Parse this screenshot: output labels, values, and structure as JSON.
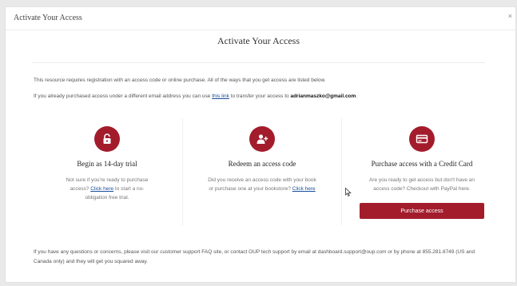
{
  "window": {
    "title": "Activate Your Access",
    "close_glyph": "×"
  },
  "page": {
    "title": "Activate Your Access"
  },
  "intro": {
    "line1": "This resource requires registration with an access code or online purchase. All of the ways that you get access are listed below.",
    "line2_prefix": "If you already purchased access under a different email address you can use ",
    "line2_link": "this link",
    "line2_middle": " to transfer your access to ",
    "email": "adrianmaszko@gmail.com",
    "line2_suffix": "."
  },
  "options": [
    {
      "icon": "lock-icon",
      "heading": "Begin as 14-day trial",
      "text_before": "Not sure if you're ready to purchase access? ",
      "link": "Click here",
      "text_after": " to start a no-obligation free trial."
    },
    {
      "icon": "add-user-icon",
      "heading": "Redeem an access code",
      "text_before": "Did you receive an access code with your book or purchase one at your bookstore? ",
      "link": "Click here",
      "text_after": ""
    },
    {
      "icon": "credit-card-icon",
      "heading": "Purchase access with a Credit Card",
      "text": "Are you ready to get access but don't have an access code? Checkout with PayPal here.",
      "button_label": "Purchase access"
    }
  ],
  "footer": {
    "text": "If you have any questions or concerns, please visit our customer support FAQ site, or contact OUP tech support by email at dashboard.support@oup.com or by phone at 855.281.8749 (US and Canada only) and they will get you squared away."
  },
  "colors": {
    "accent": "#a31c2c",
    "link": "#1a4e9a"
  }
}
